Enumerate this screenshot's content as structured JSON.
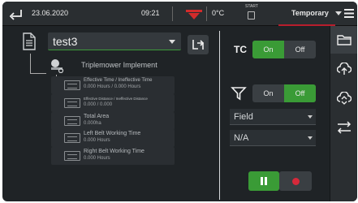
{
  "topbar": {
    "date": "23.06.2020",
    "time": "09:21",
    "temperature": "0°C",
    "start_label": "START",
    "mode": "Temporary"
  },
  "file": {
    "selected": "test3"
  },
  "implement": {
    "label": "Triplemower Implement"
  },
  "counters": [
    {
      "name": "Effective Time / Ineffective Time",
      "value": "0.000 Hours / 0.000 Hours"
    },
    {
      "name": "Effective Distance / Ineffective Distance",
      "value": "0.000 / 0.000"
    },
    {
      "name": "Total Area",
      "value": "0.000ha"
    },
    {
      "name": "Left Belt Working Time",
      "value": "0.000 Hours"
    },
    {
      "name": "Right Belt Working Time",
      "value": "0.000 Hours"
    }
  ],
  "tc": {
    "label": "TC",
    "on": "On",
    "off": "Off",
    "state": "On"
  },
  "filter": {
    "on": "On",
    "off": "Off",
    "state": "Off"
  },
  "dropdowns": {
    "field": "Field",
    "na": "N/A"
  },
  "colors": {
    "accent_green": "#3a9b36",
    "brand_red": "#b81e2c",
    "record_red": "#d6293a"
  },
  "sidebar": {
    "items": [
      {
        "icon": "folder-icon",
        "active": true
      },
      {
        "icon": "cloud-upload-icon",
        "active": false
      },
      {
        "icon": "cloud-sync-icon",
        "active": false
      },
      {
        "icon": "usb-transfer-icon",
        "active": false
      }
    ]
  }
}
